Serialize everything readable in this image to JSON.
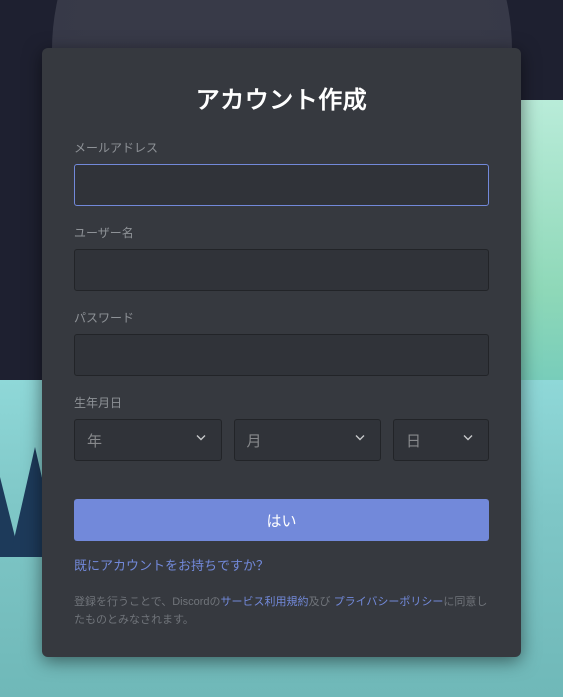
{
  "modal": {
    "title": "アカウント作成",
    "fields": {
      "email_label": "メールアドレス",
      "username_label": "ユーザー名",
      "password_label": "パスワード",
      "dob_label": "生年月日"
    },
    "dob": {
      "year_placeholder": "年",
      "month_placeholder": "月",
      "day_placeholder": "日"
    },
    "submit_label": "はい",
    "login_link_text": "既にアカウントをお持ちですか？",
    "terms": {
      "prefix": "登録を行うことで、Discordの",
      "tos": "サービス利用規約",
      "and": "及び",
      "privacy": "プライバシーポリシー",
      "suffix": "に同意したものとみなされます。"
    }
  }
}
